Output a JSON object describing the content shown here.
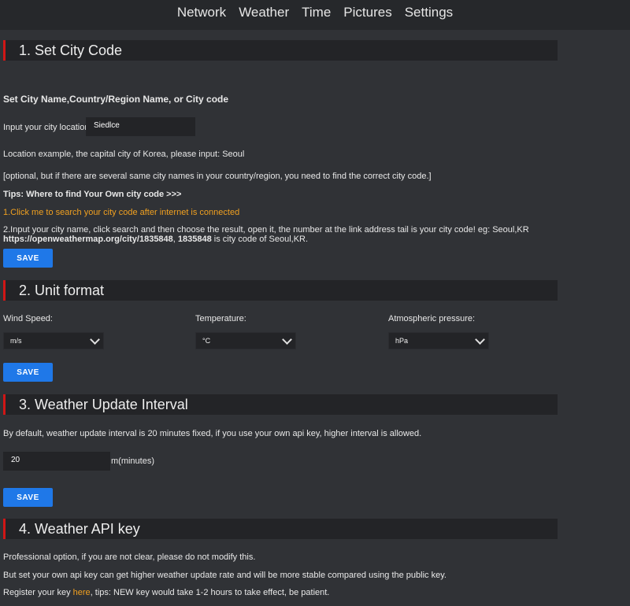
{
  "nav": {
    "items": [
      "Network",
      "Weather",
      "Time",
      "Pictures",
      "Settings"
    ]
  },
  "section1": {
    "header": "1. Set City Code",
    "subtitle": "Set City Name,Country/Region Name, or City code",
    "input_label": "Input your city location:",
    "input_value": "Siedlce",
    "example": "Location example, the capital city of Korea, please input: Seoul",
    "optional": "[optional, but if there are several same city names in your country/region, you need to find the correct city code.]",
    "tips": "Tips:  Where to find Your Own city code >>>",
    "step1": "1.Click me to search your city code after internet is connected",
    "step2_line1": "2.Input your city name, click search and then choose the result, open it, the number at the link address tail is your city code! eg: Seoul,KR",
    "step2_url": "https://openweathermap.org/city/1835848",
    "step2_sep": ", ",
    "step2_code": "1835848",
    "step2_tail": " is city code of Seoul,KR.",
    "save": "SAVE"
  },
  "section2": {
    "header": "2. Unit format",
    "wind_label": "Wind Speed:",
    "wind_value": "m/s",
    "temp_label": "Temperature:",
    "temp_value": "°C",
    "pressure_label": "Atmospheric pressure:",
    "pressure_value": "hPa",
    "save": "SAVE"
  },
  "section3": {
    "header": "3. Weather Update Interval",
    "desc": "By default, weather update interval is 20 minutes fixed, if you use your own api key, higher interval is allowed.",
    "interval_value": "20",
    "unit": "m(minutes)",
    "save": "SAVE"
  },
  "section4": {
    "header": "4. Weather API key",
    "line1": "Professional option, if you are not clear, please do not modify this.",
    "line2": "But set your own api key can get higher weather update rate and will be more stable compared using the public key.",
    "line3_pre": "Register your key ",
    "line3_link": "here",
    "line3_post": ", tips: NEW key would take 1-2 hours to take effect, be patient."
  },
  "colors": {
    "accent": "#1f78e8",
    "header_bar": "#d01616",
    "highlight": "#f0a020"
  }
}
